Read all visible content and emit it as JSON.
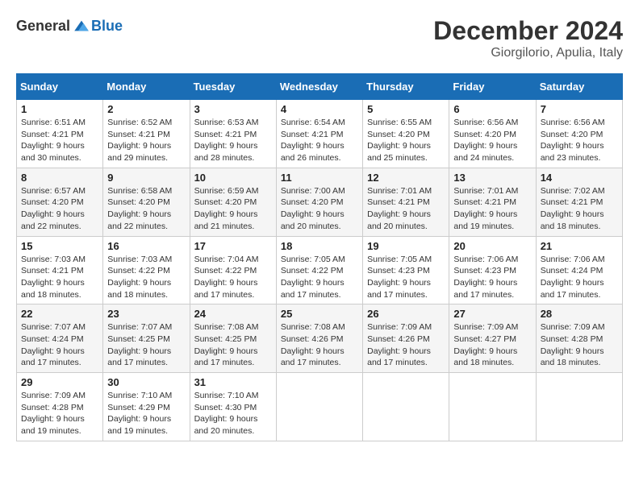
{
  "header": {
    "logo": {
      "text_general": "General",
      "text_blue": "Blue"
    },
    "title": "December 2024",
    "subtitle": "Giorgilorio, Apulia, Italy"
  },
  "days_of_week": [
    "Sunday",
    "Monday",
    "Tuesday",
    "Wednesday",
    "Thursday",
    "Friday",
    "Saturday"
  ],
  "weeks": [
    [
      {
        "day": "1",
        "sunrise": "6:51 AM",
        "sunset": "4:21 PM",
        "daylight": "9 hours and 30 minutes."
      },
      {
        "day": "2",
        "sunrise": "6:52 AM",
        "sunset": "4:21 PM",
        "daylight": "9 hours and 29 minutes."
      },
      {
        "day": "3",
        "sunrise": "6:53 AM",
        "sunset": "4:21 PM",
        "daylight": "9 hours and 28 minutes."
      },
      {
        "day": "4",
        "sunrise": "6:54 AM",
        "sunset": "4:21 PM",
        "daylight": "9 hours and 26 minutes."
      },
      {
        "day": "5",
        "sunrise": "6:55 AM",
        "sunset": "4:20 PM",
        "daylight": "9 hours and 25 minutes."
      },
      {
        "day": "6",
        "sunrise": "6:56 AM",
        "sunset": "4:20 PM",
        "daylight": "9 hours and 24 minutes."
      },
      {
        "day": "7",
        "sunrise": "6:56 AM",
        "sunset": "4:20 PM",
        "daylight": "9 hours and 23 minutes."
      }
    ],
    [
      {
        "day": "8",
        "sunrise": "6:57 AM",
        "sunset": "4:20 PM",
        "daylight": "9 hours and 22 minutes."
      },
      {
        "day": "9",
        "sunrise": "6:58 AM",
        "sunset": "4:20 PM",
        "daylight": "9 hours and 22 minutes."
      },
      {
        "day": "10",
        "sunrise": "6:59 AM",
        "sunset": "4:20 PM",
        "daylight": "9 hours and 21 minutes."
      },
      {
        "day": "11",
        "sunrise": "7:00 AM",
        "sunset": "4:20 PM",
        "daylight": "9 hours and 20 minutes."
      },
      {
        "day": "12",
        "sunrise": "7:01 AM",
        "sunset": "4:21 PM",
        "daylight": "9 hours and 20 minutes."
      },
      {
        "day": "13",
        "sunrise": "7:01 AM",
        "sunset": "4:21 PM",
        "daylight": "9 hours and 19 minutes."
      },
      {
        "day": "14",
        "sunrise": "7:02 AM",
        "sunset": "4:21 PM",
        "daylight": "9 hours and 18 minutes."
      }
    ],
    [
      {
        "day": "15",
        "sunrise": "7:03 AM",
        "sunset": "4:21 PM",
        "daylight": "9 hours and 18 minutes."
      },
      {
        "day": "16",
        "sunrise": "7:03 AM",
        "sunset": "4:22 PM",
        "daylight": "9 hours and 18 minutes."
      },
      {
        "day": "17",
        "sunrise": "7:04 AM",
        "sunset": "4:22 PM",
        "daylight": "9 hours and 17 minutes."
      },
      {
        "day": "18",
        "sunrise": "7:05 AM",
        "sunset": "4:22 PM",
        "daylight": "9 hours and 17 minutes."
      },
      {
        "day": "19",
        "sunrise": "7:05 AM",
        "sunset": "4:23 PM",
        "daylight": "9 hours and 17 minutes."
      },
      {
        "day": "20",
        "sunrise": "7:06 AM",
        "sunset": "4:23 PM",
        "daylight": "9 hours and 17 minutes."
      },
      {
        "day": "21",
        "sunrise": "7:06 AM",
        "sunset": "4:24 PM",
        "daylight": "9 hours and 17 minutes."
      }
    ],
    [
      {
        "day": "22",
        "sunrise": "7:07 AM",
        "sunset": "4:24 PM",
        "daylight": "9 hours and 17 minutes."
      },
      {
        "day": "23",
        "sunrise": "7:07 AM",
        "sunset": "4:25 PM",
        "daylight": "9 hours and 17 minutes."
      },
      {
        "day": "24",
        "sunrise": "7:08 AM",
        "sunset": "4:25 PM",
        "daylight": "9 hours and 17 minutes."
      },
      {
        "day": "25",
        "sunrise": "7:08 AM",
        "sunset": "4:26 PM",
        "daylight": "9 hours and 17 minutes."
      },
      {
        "day": "26",
        "sunrise": "7:09 AM",
        "sunset": "4:26 PM",
        "daylight": "9 hours and 17 minutes."
      },
      {
        "day": "27",
        "sunrise": "7:09 AM",
        "sunset": "4:27 PM",
        "daylight": "9 hours and 18 minutes."
      },
      {
        "day": "28",
        "sunrise": "7:09 AM",
        "sunset": "4:28 PM",
        "daylight": "9 hours and 18 minutes."
      }
    ],
    [
      {
        "day": "29",
        "sunrise": "7:09 AM",
        "sunset": "4:28 PM",
        "daylight": "9 hours and 19 minutes."
      },
      {
        "day": "30",
        "sunrise": "7:10 AM",
        "sunset": "4:29 PM",
        "daylight": "9 hours and 19 minutes."
      },
      {
        "day": "31",
        "sunrise": "7:10 AM",
        "sunset": "4:30 PM",
        "daylight": "9 hours and 20 minutes."
      },
      null,
      null,
      null,
      null
    ]
  ],
  "labels": {
    "sunrise": "Sunrise:",
    "sunset": "Sunset:",
    "daylight": "Daylight:"
  }
}
